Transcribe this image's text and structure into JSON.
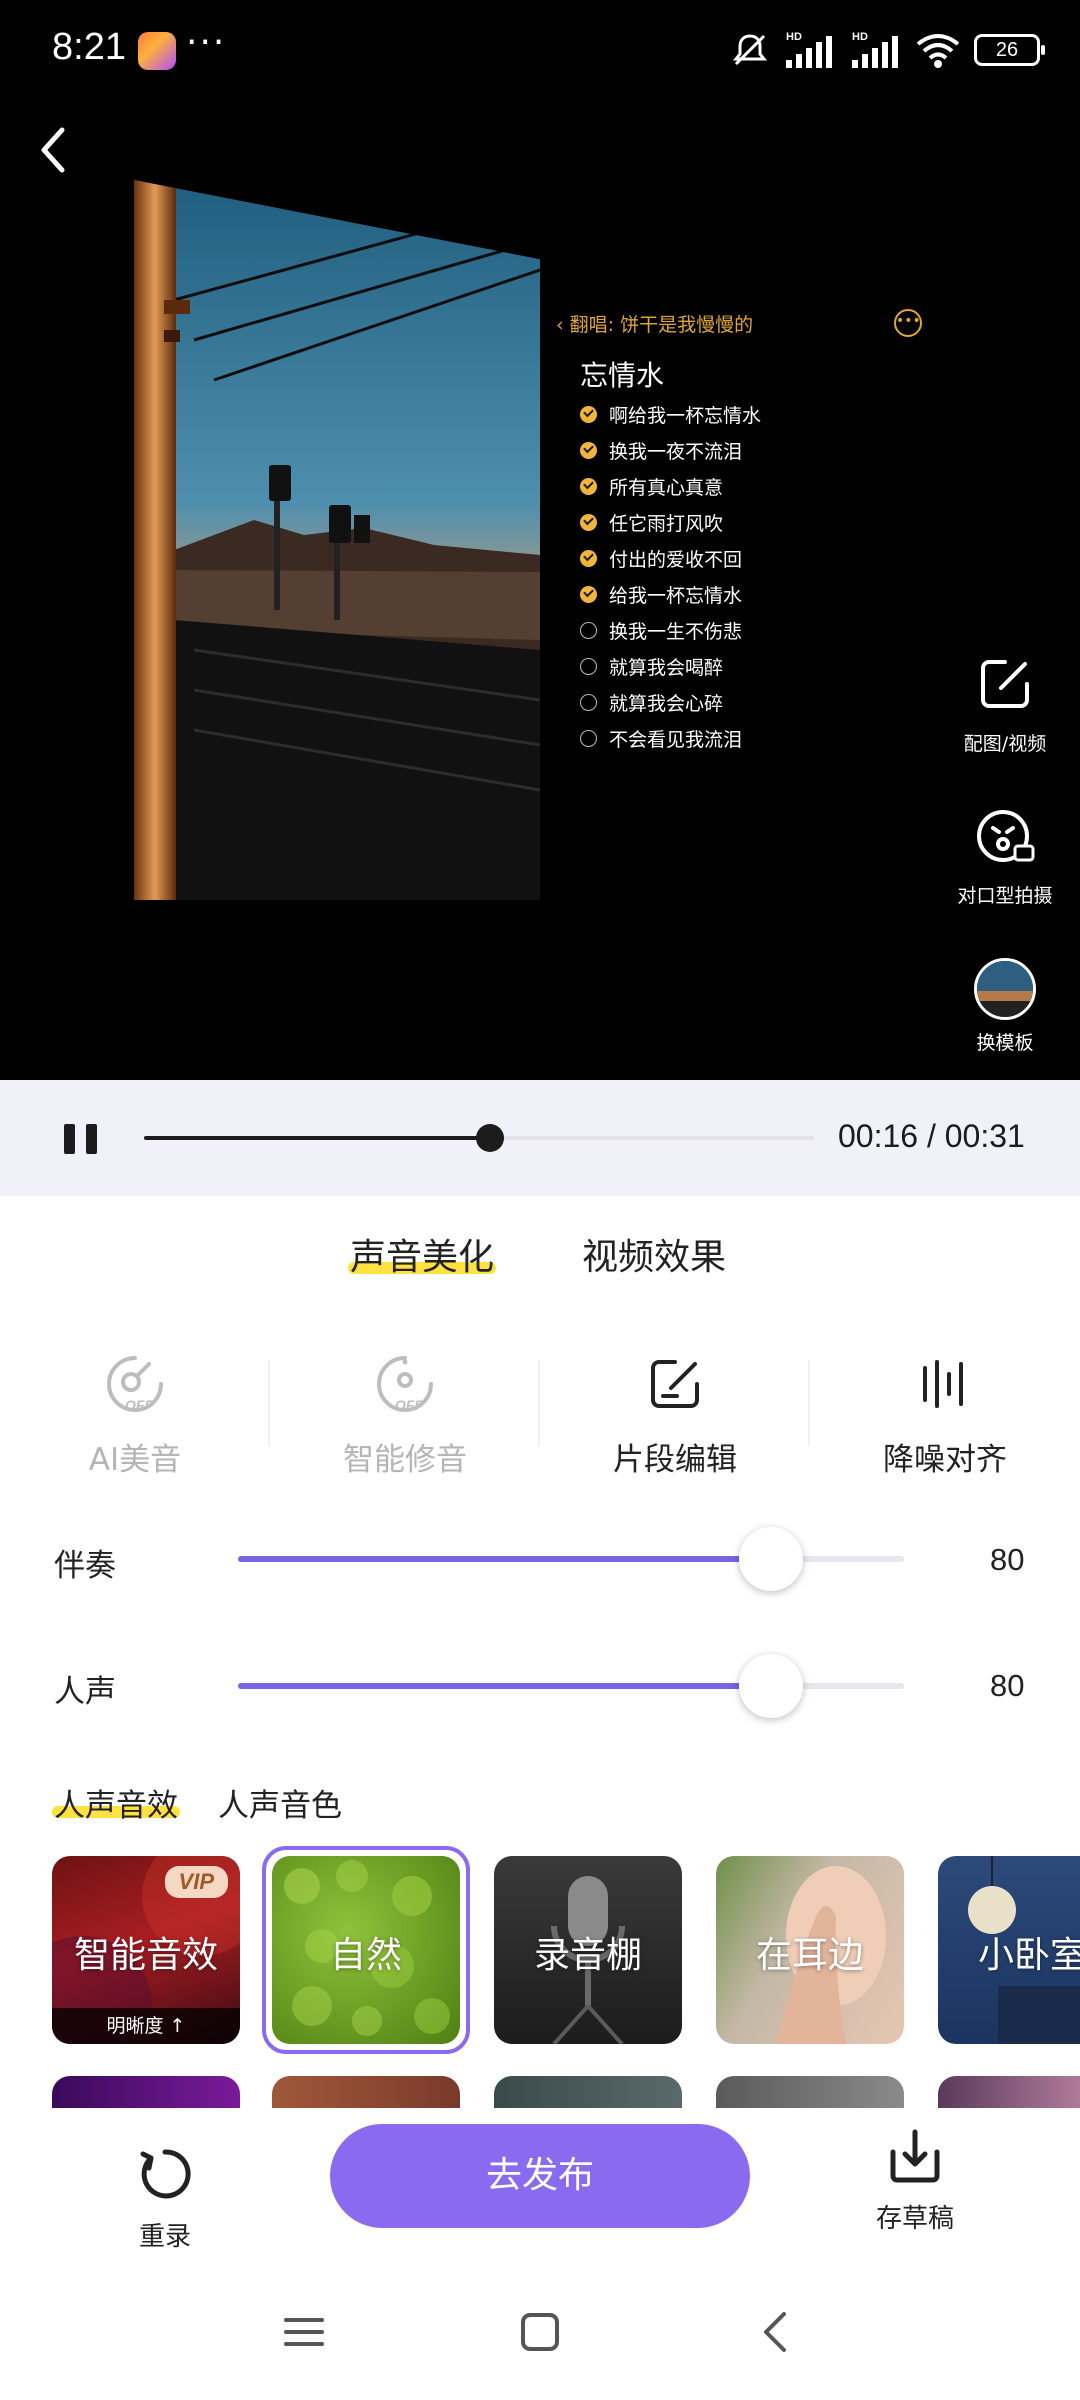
{
  "status_bar": {
    "time": "8:21",
    "dots": "···",
    "battery": "26",
    "icons": [
      "app-icon",
      "mute-icon",
      "hd-signal-icon",
      "hd-signal-icon",
      "wifi-icon",
      "battery-icon"
    ]
  },
  "preview": {
    "singer_line": "翻唱: 饼干是我慢慢的",
    "song_title": "忘情水",
    "lyrics": [
      {
        "text": "啊给我一杯忘情水",
        "checked": true
      },
      {
        "text": "换我一夜不流泪",
        "checked": true
      },
      {
        "text": "所有真心真意",
        "checked": true
      },
      {
        "text": "任它雨打风吹",
        "checked": true
      },
      {
        "text": "付出的爱收不回",
        "checked": true
      },
      {
        "text": "给我一杯忘情水",
        "checked": true
      },
      {
        "text": "换我一生不伤悲",
        "checked": false
      },
      {
        "text": "就算我会喝醉",
        "checked": false
      },
      {
        "text": "就算我会心碎",
        "checked": false
      },
      {
        "text": "不会看见我流泪",
        "checked": false
      }
    ],
    "side_tools": {
      "image_video": "配图/视频",
      "lip_sync": "对口型拍摄",
      "template": "换模板"
    }
  },
  "player": {
    "time_text": "00:16 / 00:31",
    "progress": 0.5161
  },
  "tabs": {
    "voice_beautify": "声音美化",
    "video_effects": "视频效果"
  },
  "tools": {
    "ai_beauty": "AI美音",
    "smart_fix": "智能修音",
    "segment_edit": "片段编辑",
    "denoise_align": "降噪对齐"
  },
  "sliders": {
    "accompaniment": {
      "label": "伴奏",
      "value": "80",
      "level": 0.8
    },
    "vocal": {
      "label": "人声",
      "value": "80",
      "level": 0.8
    }
  },
  "effect_tabs": {
    "vocal_effect": "人声音效",
    "vocal_timbre": "人声音色"
  },
  "effects": [
    {
      "name": "智能音效",
      "badge": "VIP",
      "sub": "明晰度 ↑"
    },
    {
      "name": "自然",
      "selected": true
    },
    {
      "name": "录音棚"
    },
    {
      "name": "在耳边"
    },
    {
      "name": "小卧室"
    }
  ],
  "actions": {
    "rerecord": "重录",
    "publish": "去发布",
    "save_draft": "存草稿"
  },
  "colors": {
    "accent": "#8a6bf0",
    "tab_highlight": "#ffe23f",
    "lyric_gold": "#e0a635"
  }
}
